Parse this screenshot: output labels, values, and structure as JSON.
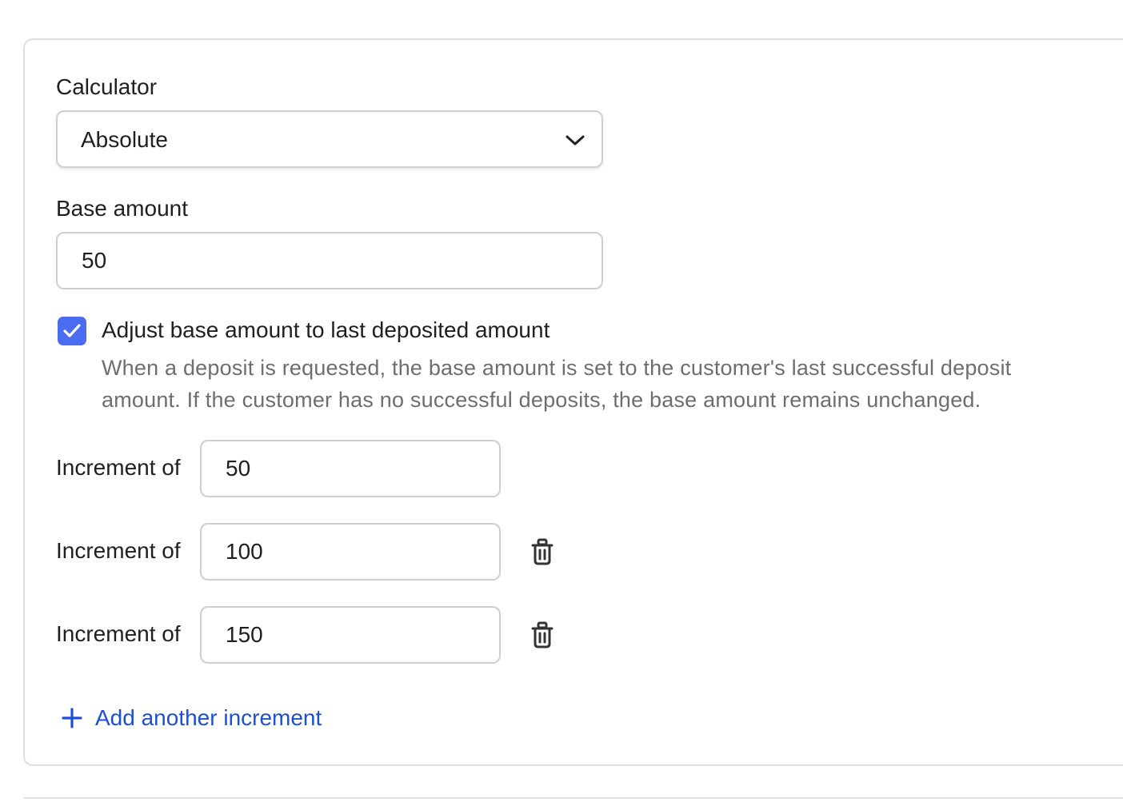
{
  "form": {
    "calculator_label": "Calculator",
    "calculator_value": "Absolute",
    "base_amount_label": "Base amount",
    "base_amount_value": "50",
    "adjust_label": "Adjust base amount to last deposited amount",
    "adjust_checked": true,
    "adjust_help": "When a deposit is requested, the base amount is set to the customer's last successful deposit amount. If the customer has no successful deposits, the base amount remains unchanged.",
    "increments": [
      {
        "label": "Increment of",
        "value": "50"
      },
      {
        "label": "Increment of",
        "value": "100"
      },
      {
        "label": "Increment of",
        "value": "150"
      }
    ],
    "add_increment_label": "Add another increment"
  },
  "colors": {
    "accent": "#4a6cf0",
    "link": "#1d4fd6",
    "border": "#cfcfcf"
  },
  "icons": {
    "select": "chevron-down-icon",
    "checkbox": "checkmark-icon",
    "remove": "trash-icon",
    "add": "plus-icon"
  }
}
